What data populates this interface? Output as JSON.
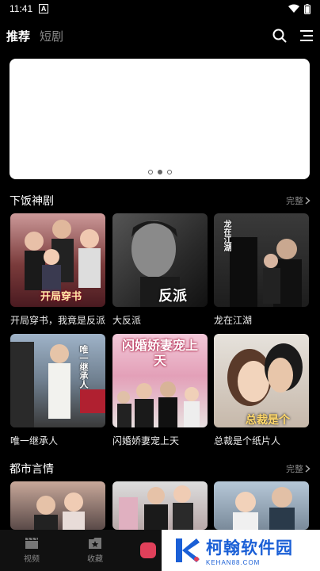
{
  "status": {
    "time": "11:41",
    "a_icon": "A"
  },
  "tabs": [
    {
      "label": "推荐",
      "active": true
    },
    {
      "label": "短剧",
      "active": false
    }
  ],
  "sections": [
    {
      "title": "下饭神剧",
      "more": "完整",
      "items": [
        {
          "title": "开局穿书，我竟是反派",
          "poster_text": "开局穿书"
        },
        {
          "title": "大反派",
          "poster_text": "反派"
        },
        {
          "title": "龙在江湖",
          "poster_text": "龙在江湖"
        },
        {
          "title": "唯一继承人",
          "poster_text": "唯一继承人"
        },
        {
          "title": "闪婚娇妻宠上天",
          "poster_text": "闪婚娇妻宠上天"
        },
        {
          "title": "总裁是个纸片人",
          "poster_text": "总裁是个"
        }
      ]
    },
    {
      "title": "都市言情",
      "more": "完整",
      "items": []
    }
  ],
  "bottom_nav": [
    {
      "label": "视频",
      "icon": "clapper-icon"
    },
    {
      "label": "收藏",
      "icon": "star-folder-icon"
    }
  ],
  "watermark": {
    "main": "柯翰软件园",
    "sub": "KEHAN88.COM"
  },
  "colors": {
    "background": "#000000",
    "accent": "#1a5fd6"
  }
}
